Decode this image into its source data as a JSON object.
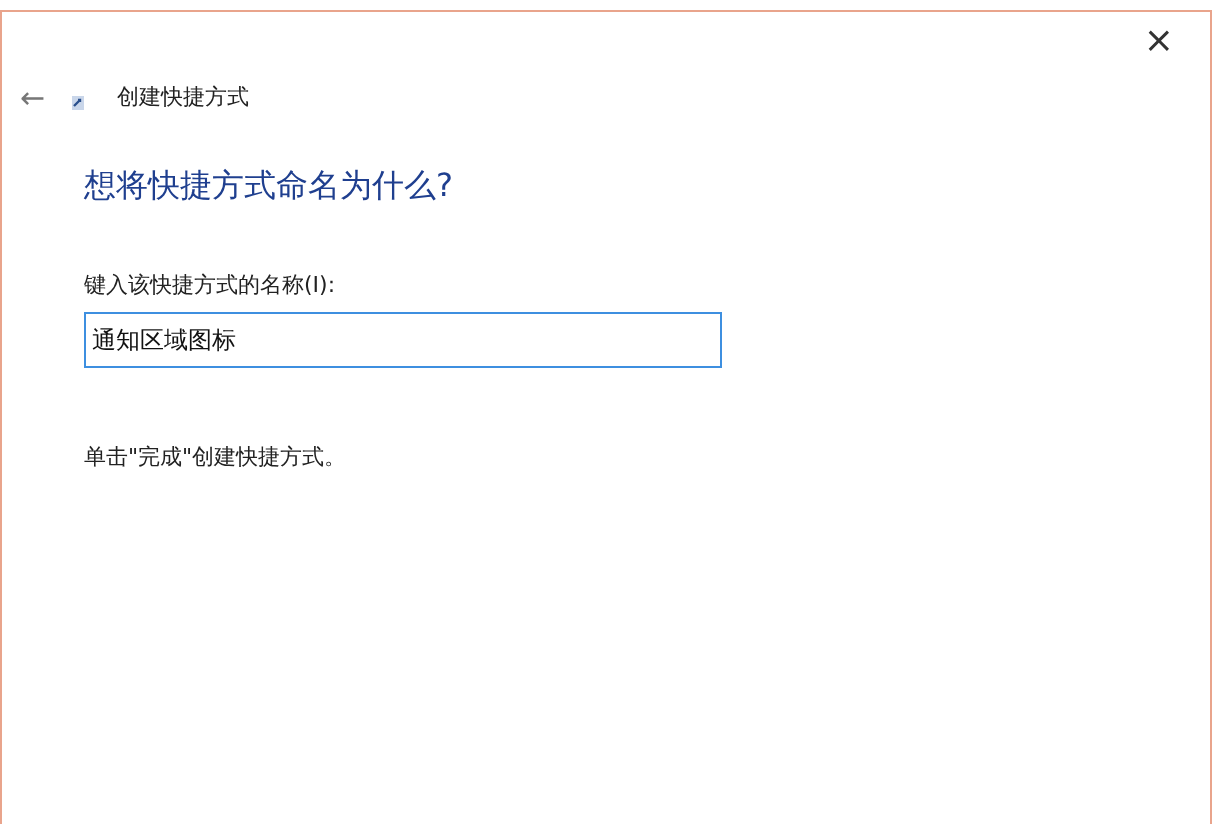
{
  "window": {
    "title": "创建快捷方式",
    "close": "×",
    "back": "←"
  },
  "heading": "想将快捷方式命名为什么?",
  "name_field": {
    "label": "键入该快捷方式的名称(I):",
    "value": "通知区域图标",
    "focused": true
  },
  "instruction": "单击\"完成\"创建快捷方式。"
}
